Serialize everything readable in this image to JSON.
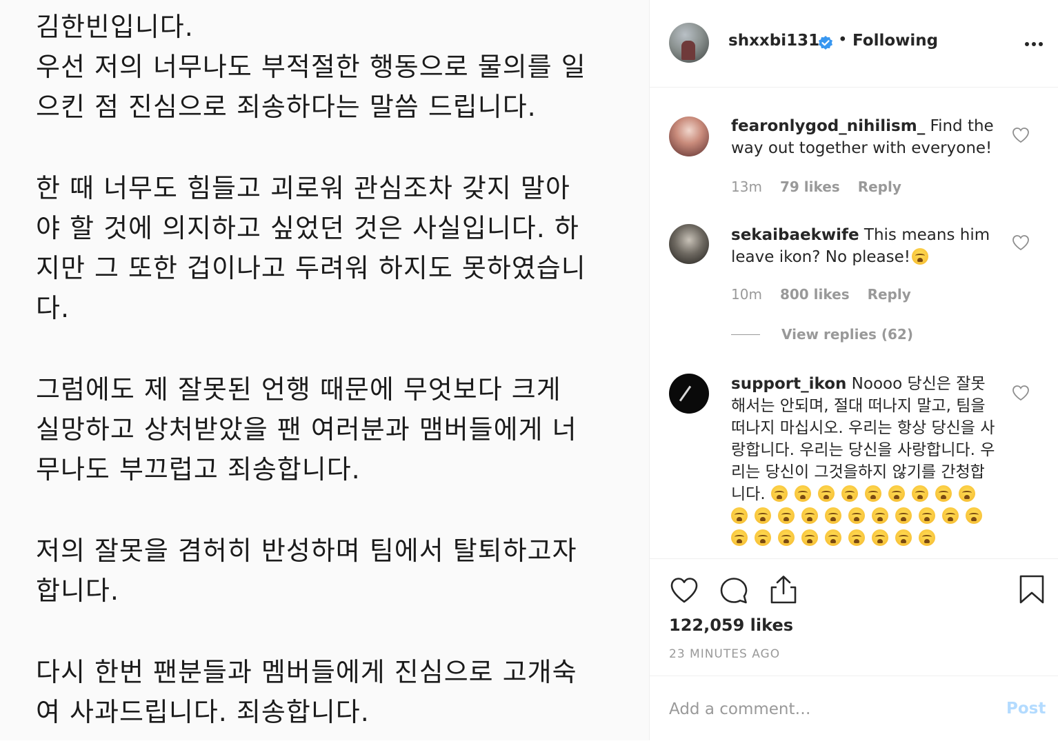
{
  "post_image": {
    "lines": [
      "김한빈입니다.",
      "우선 저의 너무나도 부적절한 행동으로 물의를 일",
      "으킨 점 진심으로 죄송하다는 말씀 드립니다.",
      "한 때 너무도 힘들고 괴로워 관심조차 갖지 말아",
      "야 할 것에 의지하고 싶었던 것은 사실입니다. 하",
      "지만 그 또한 겁이나고 두려워 하지도 못하였습니",
      "다.",
      "그럼에도 제 잘못된 언행 때문에 무엇보다 크게",
      "실망하고 상처받았을 팬 여러분과 맴버들에게 너",
      "무나도 부끄럽고 죄송합니다.",
      "저의 잘못을 겸허히 반성하며 팀에서 탈퇴하고자",
      "합니다.",
      "다시 한번 팬분들과 멤버들에게 진심으로 고개숙",
      "여 사과드립니다. 죄송합니다."
    ]
  },
  "header": {
    "username": "shxxbi131",
    "separator": "•",
    "follow_status": "Following"
  },
  "comments": [
    {
      "username": "fearonlygod_nihilism_",
      "text": " Find the way out together with everyone!",
      "time": "13m",
      "likes": "79 likes",
      "reply": "Reply"
    },
    {
      "username": "sekaibaekwife",
      "text": " This means him leave ikon? No please!",
      "emoji_count": 1,
      "time": "10m",
      "likes": "800 likes",
      "reply": "Reply",
      "view_replies": "View replies (62)"
    },
    {
      "username": "support_ikon",
      "text": " Noooo 당신은 잘못 해서는 안되며, 절대 떠나지 말고, 팀을 떠나지 마십시오. 우리는 항상 당신을 사랑합니다. 우리는 당신을 사랑합니다. 우리는 당신이 그것을하지 않기를 간청합니다.",
      "emoji_count": 29
    }
  ],
  "actions": {
    "likes": "122,059 likes",
    "time_ago": "23 MINUTES AGO"
  },
  "comment_box": {
    "placeholder": "Add a comment…",
    "post_label": "Post"
  },
  "icons": {
    "verified": "verified-badge-icon",
    "more": "more-options-icon",
    "heart": "heart-icon",
    "comment": "comment-icon",
    "share": "share-icon",
    "save": "bookmark-icon",
    "emoji": "loudly-crying-face-emoji"
  },
  "colors": {
    "verified_blue": "#3897f0",
    "muted_text": "#999999",
    "post_button_disabled": "#b3dbff"
  }
}
